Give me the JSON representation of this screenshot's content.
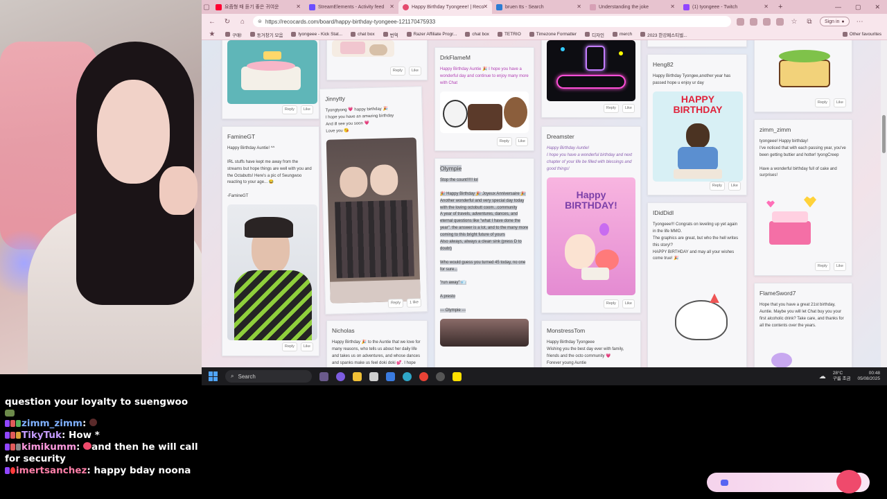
{
  "tabs": [
    {
      "label": "요즘형 때 듣기 좋은 귀여운"
    },
    {
      "label": "StreamElements - Activity feed"
    },
    {
      "label": "Happy Birthday Tyongeee! | Reco"
    },
    {
      "label": "bruen tts - Search"
    },
    {
      "label": "Understanding the joke"
    },
    {
      "label": "(1) tyongeee - Twitch"
    }
  ],
  "browser": {
    "url": "https://recocards.com/board/happy-birthday-tyongeee-121170475933",
    "signin": "Sign in"
  },
  "bookmarks": [
    "구매!",
    "동거창기 모음",
    "tyongeee - Kick Stat...",
    "chat box",
    "번역",
    "Razer Affiliate Progr...",
    "chat box",
    "TETRIO",
    "Timezone Formatter",
    "디자인",
    "merch",
    "2023 한강페스티벌...",
    "Other favourites"
  ],
  "ui": {
    "reply": "Reply",
    "like": "Like",
    "like_one": "1 like"
  },
  "cards": {
    "faminegt": {
      "name": "FamineGT",
      "message": "Happy Birthday Auntie! ^^\n\nIRL stuffs have kept me away from the streams but hope things are well with you and the Octabutts!  Here's a pic of Seungwoo reacting to your age... 😂\n\n-FamineGT"
    },
    "jinnytty": {
      "name": "Jinnytty",
      "message": "Tyongtyong 💗 happy birthday 🎉\nI hope you have an amazing birthday\nAnd ill see you soon 💗\nLove you 😘"
    },
    "nicholas": {
      "name": "Nicholas",
      "message": "Happy Birthday 🎉 to the Auntie that we love for many reasons, who tells us about her daily life and takes us on adventures, and whose dances and spanks make us feel doki doki 💕. I hope"
    },
    "drkflamem": {
      "name": "DrkFlameM",
      "message": "Happy Birthday Auntie 🎉  I hope you have a wonderful day and continue to enjoy many more with Chat"
    },
    "olympie": {
      "name": "Olympie",
      "message": "Stop the count!!!!! lol\n\n🎉 Happy Birthday 🎉 Joyeux Anniversaire 🎉 Another wonderful and very special day today with the loving octobutt coom...community\nA year of travels, adventures, dances, and eternal questions like \"what I have done the year\". the answer is a lot, and to the many more coming to this bright future of yours\nAlso always, always a clean sink (press D to doubt)\n\nWho would guess you turned 45 today, no one for sure...\n\n\"run away\" 💨\n\nA presto\n\n--- Olympie ---"
    },
    "dreamster": {
      "name": "Dreamster",
      "message": "Happy Birthday Auntie!\nI hope you have a wonderful birthday and next chapter of your life be filled with blessings and good things!",
      "image_title": "Happy BIRTHDAY!"
    },
    "monstresstom": {
      "name": "MonstressTom",
      "message": "Happy Birthday Tyongeee\nWishing you the best day ever with family, friends and the octo community 💗\nForever young Auntie"
    },
    "heng82": {
      "name": "Heng82",
      "message": "Happy Birthday Tyongee,another year has passed hope u enjoy ur day",
      "image_title": "HAPPY BIRTHDAY"
    },
    "ididdidl": {
      "name": "IDidDidI",
      "message": "Tyongeee!!! Congrats on leveling up yet again in the life MMO.\nThe graphics are great, but who the hell writes this story!?\nHAPPY BIRTHDAY and may all your wishes come true! 🎉"
    },
    "zimm_zimm": {
      "name": "zimm_zimm",
      "message": "tyongeee! Happy birthday!\nI've noticed that with each passing year, you've been getting buttier and hotter! tyongCreep\n\nHave a wonderful birthday full of cake and surprises!"
    },
    "flamesword7": {
      "name": "FlameSword7",
      "message": "Hope that you have a great 21st birthday, Auntie. Maybe you will let Chat buy you your first alcoholic drink? Take care, and thanks for all the contents over the years."
    }
  },
  "taskbar": {
    "search": "Search",
    "temp": "28°C",
    "weather": "구름 조금",
    "time": "00:48",
    "date": "05/08/2025"
  },
  "chat": [
    {
      "text": "question your loyalty to suengwoo"
    },
    {
      "user": "zimm_zimm",
      "text": ""
    },
    {
      "user": "TikyTuk",
      "text": "How *"
    },
    {
      "user": "kimikumm",
      "text": "and then he will call for security"
    },
    {
      "user": "imertsanchez",
      "text": "happy bday noona"
    }
  ]
}
